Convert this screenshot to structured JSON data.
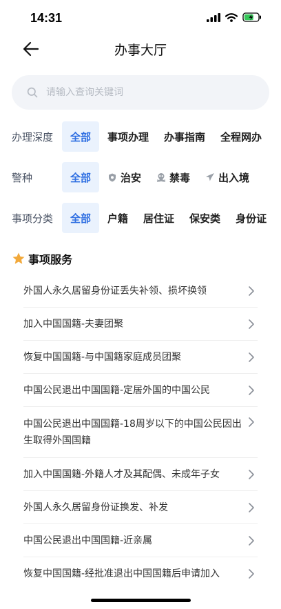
{
  "status": {
    "time": "14:31"
  },
  "nav": {
    "title": "办事大厅"
  },
  "search": {
    "placeholder": "请输入查询关键词"
  },
  "filters": [
    {
      "label": "办理深度",
      "options": [
        {
          "text": "全部",
          "active": true,
          "icon": ""
        },
        {
          "text": "事项办理",
          "active": false,
          "icon": ""
        },
        {
          "text": "办事指南",
          "active": false,
          "icon": ""
        },
        {
          "text": "全程网办",
          "active": false,
          "icon": ""
        }
      ]
    },
    {
      "label": "警种",
      "options": [
        {
          "text": "全部",
          "active": true,
          "icon": ""
        },
        {
          "text": "治安",
          "active": false,
          "icon": "shield-icon"
        },
        {
          "text": "禁毒",
          "active": false,
          "icon": "skull-icon"
        },
        {
          "text": "出入境",
          "active": false,
          "icon": "airplane-icon"
        }
      ]
    },
    {
      "label": "事项分类",
      "options": [
        {
          "text": "全部",
          "active": true,
          "icon": ""
        },
        {
          "text": "户籍",
          "active": false,
          "icon": ""
        },
        {
          "text": "居住证",
          "active": false,
          "icon": ""
        },
        {
          "text": "保安类",
          "active": false,
          "icon": ""
        },
        {
          "text": "身份证",
          "active": false,
          "icon": ""
        }
      ]
    }
  ],
  "section": {
    "title": "事项服务",
    "icon": "star-icon",
    "accent": "#f2a93b"
  },
  "services": [
    "外国人永久居留身份证丢失补领、损坏换领",
    "加入中国国籍-夫妻团聚",
    "恢复中国国籍-与中国籍家庭成员团聚",
    "中国公民退出中国国籍-定居外国的中国公民",
    "中国公民退出中国国籍-18周岁以下的中国公民因出生取得外国国籍",
    "加入中国国籍-外籍人才及其配偶、未成年子女",
    "外国人永久居留身份证换发、补发",
    "中国公民退出中国国籍-近亲属",
    "恢复中国国籍-经批准退出中国国籍后申请加入"
  ],
  "colors": {
    "accent": "#2f6fe2",
    "chip_bg": "#eaf2fd",
    "search_bg": "#f2f4f8"
  }
}
